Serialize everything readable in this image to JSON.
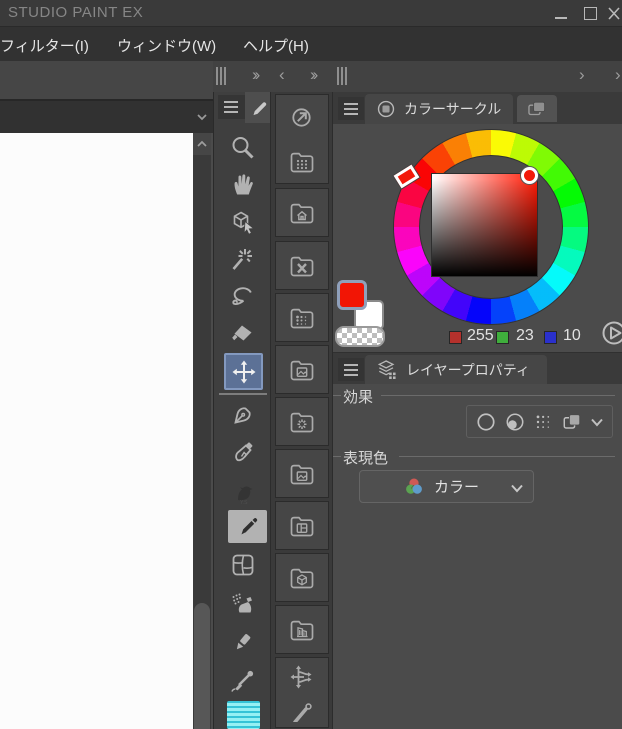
{
  "window": {
    "title": "STUDIO PAINT EX",
    "controls": [
      "minimize",
      "maximize",
      "close"
    ]
  },
  "menubar": {
    "items": [
      {
        "label": "フィルター(I)"
      },
      {
        "label": "ウィンドウ(W)"
      },
      {
        "label": "ヘルプ(H)"
      }
    ]
  },
  "toolbar": {
    "selected_tool": "move-tool",
    "secondary_selected_tool": "pencil-tool",
    "tools": [
      "zoom-tool",
      "hand-tool",
      "operate-tool",
      "auto-select-tool",
      "lasso-tool",
      "fill-tool",
      "move-tool",
      "pen-tool",
      "inking-tool",
      "decoration-tool",
      "pencil-tool",
      "frame-border-tool",
      "airbrush-tool",
      "correction-tool",
      "eyedropper-tool",
      "gradient-tool"
    ]
  },
  "material_bar": {
    "items": [
      "quick-access-palette",
      "material-folder-grid",
      "material-folder-home",
      "material-folder-x",
      "material-folder-halftone",
      "material-folder-image",
      "material-folder-burst",
      "material-folder-image-2",
      "material-folder-layout",
      "material-folder-3d",
      "material-folder-building",
      "transform-palette",
      "pen-palette"
    ]
  },
  "color_panel": {
    "tab": "カラーサークル",
    "rgb": {
      "r": "255",
      "g": "23",
      "b": "10"
    },
    "primary_color": "#f21505",
    "secondary_color": "#ffffff"
  },
  "layer_panel": {
    "tab": "レイヤープロパティ",
    "effect_label": "効果",
    "effect_buttons": [
      "border-effect",
      "tone-effect",
      "halftone-effect",
      "layer-color-effect"
    ],
    "expression_label": "表現色",
    "expression_value": "カラー"
  },
  "colors": {
    "selected_tool_bg": "#5c7196",
    "gradient_tool_highlight": "#8deef0",
    "panel_bg": "#4b4b4b",
    "titlebar_bg": "#3a3a3a"
  }
}
